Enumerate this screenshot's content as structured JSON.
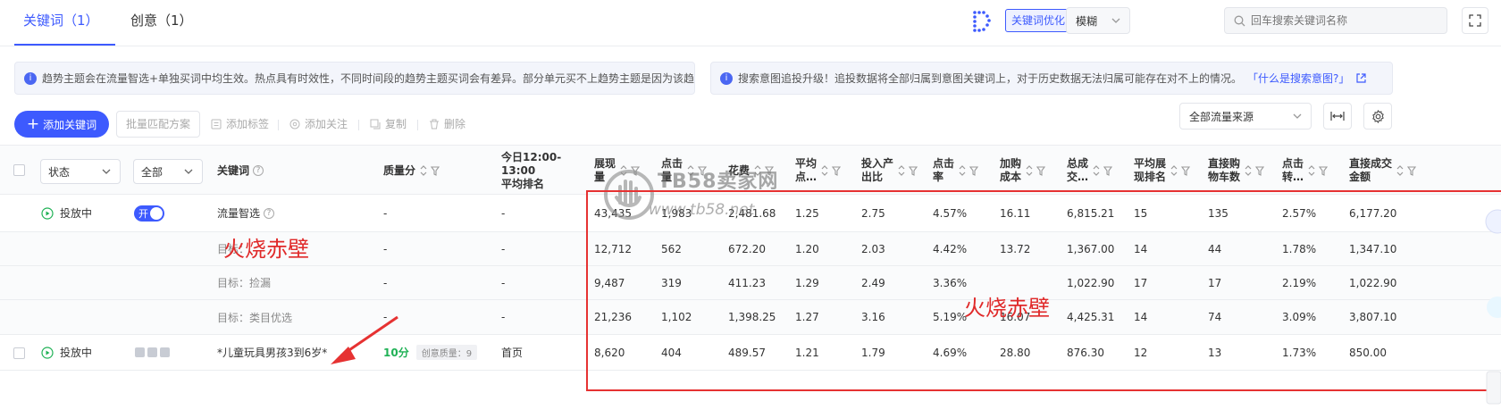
{
  "tabs": [
    {
      "label": "关键词（1）",
      "active": true
    },
    {
      "label": "创意（1）",
      "active": false
    }
  ],
  "header": {
    "keyword_optimize": "关键词优化",
    "match_mode": "模糊",
    "search_placeholder": "回车搜索关键词名称"
  },
  "notices": {
    "left": "趋势主题会在流量智选+单独买词中均生效。热点具有时效性，不同时间段的趋势主题买词会有差异。部分单元买不上趋势主题是因为该趋势…",
    "right": "搜索意图追投升级！追投数据将全部归属到意图关键词上，对于历史数据无法归属可能存在对不上的情况。",
    "right_link": "「什么是搜索意图?」"
  },
  "toolbar": {
    "add_keyword": "添加关键词",
    "batch_match": "批量匹配方案",
    "add_tag": "添加标签",
    "add_follow": "添加关注",
    "copy": "复制",
    "delete": "删除",
    "traffic_source": "全部流量来源"
  },
  "table": {
    "headers": {
      "status": "状态",
      "all": "全部",
      "keyword": "关键词",
      "quality": "质量分",
      "rank": "今日12:00-13:00\n平均排名",
      "impressions": "展现\n量",
      "clicks": "点击\n量",
      "cost": "花费",
      "avg_cpc": "平均\n点…",
      "roi": "投入产\n出比",
      "ctr": "点击\n率",
      "cart_cost": "加购\n成本",
      "total_gmv": "总成\n交…",
      "avg_pos": "平均展\n现排名",
      "direct_cart": "直接购\n物车数",
      "cvr": "点击\n转…",
      "direct_gmv": "直接成交\n金额"
    },
    "rows": [
      {
        "status": "投放中",
        "switch": "开",
        "keyword": "流量智选",
        "quality": "-",
        "rank": "-",
        "impressions": "43,435",
        "clicks": "1,983",
        "cost": "2,481.68",
        "avg_cpc": "1.25",
        "roi": "2.75",
        "ctr": "4.57%",
        "cart_cost": "16.11",
        "total_gmv": "6,815.21",
        "avg_pos": "15",
        "direct_cart": "135",
        "cvr": "2.57%",
        "direct_gmv": "6,177.20"
      },
      {
        "keyword": "目标：",
        "quality": "-",
        "rank": "-",
        "impressions": "12,712",
        "clicks": "562",
        "cost": "672.20",
        "avg_cpc": "1.20",
        "roi": "2.03",
        "ctr": "4.42%",
        "cart_cost": "13.72",
        "total_gmv": "1,367.00",
        "avg_pos": "14",
        "direct_cart": "44",
        "cvr": "1.78%",
        "direct_gmv": "1,347.10"
      },
      {
        "keyword": "目标：捡漏",
        "quality": "-",
        "rank": "-",
        "impressions": "9,487",
        "clicks": "319",
        "cost": "411.23",
        "avg_cpc": "1.29",
        "roi": "2.49",
        "ctr": "3.36%",
        "cart_cost": "",
        "total_gmv": "1,022.90",
        "avg_pos": "17",
        "direct_cart": "17",
        "cvr": "2.19%",
        "direct_gmv": "1,022.90"
      },
      {
        "keyword": "目标：类目优选",
        "quality": "-",
        "rank": "-",
        "impressions": "21,236",
        "clicks": "1,102",
        "cost": "1,398.25",
        "avg_cpc": "1.27",
        "roi": "3.16",
        "ctr": "5.19%",
        "cart_cost": "16.07",
        "total_gmv": "4,425.31",
        "avg_pos": "14",
        "direct_cart": "74",
        "cvr": "3.09%",
        "direct_gmv": "3,807.10"
      },
      {
        "status": "投放中",
        "keyword": "*儿童玩具男孩3到6岁*",
        "quality": "10分",
        "quality_badge": "创意质量：9",
        "rank": "首页",
        "impressions": "8,620",
        "clicks": "404",
        "cost": "489.57",
        "avg_cpc": "1.21",
        "roi": "1.79",
        "ctr": "4.69%",
        "cart_cost": "28.80",
        "total_gmv": "876.30",
        "avg_pos": "12",
        "direct_cart": "13",
        "cvr": "1.73%",
        "direct_gmv": "850.00"
      }
    ]
  },
  "overlays": {
    "watermark_title": "TB58卖家网",
    "watermark_url": "www.tb58.net",
    "annotation_1": "火烧赤壁",
    "annotation_2": "火烧赤壁"
  },
  "colors": {
    "primary": "#3d5afe",
    "success": "#1fb155",
    "annotation_red": "#e02a2a"
  }
}
